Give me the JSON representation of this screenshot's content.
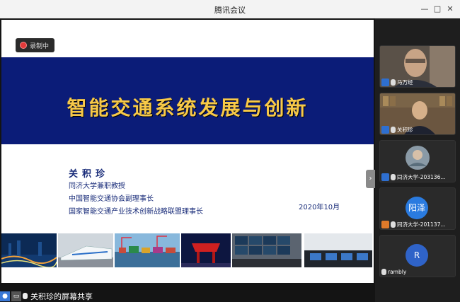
{
  "window": {
    "title": "腾讯会议",
    "controls": [
      "—",
      "□",
      "✕"
    ]
  },
  "recording": {
    "label": "录制中"
  },
  "slide": {
    "title": "智能交通系统发展与创新",
    "presenter": "关积珍",
    "roles": [
      "同济大学兼职教授",
      "中国智能交通协会副理事长",
      "国家智能交通产业技术创新战略联盟理事长"
    ],
    "date": "2020年10月"
  },
  "participants": [
    {
      "name": "马万经",
      "badge": "blue",
      "type": "video"
    },
    {
      "name": "关积珍",
      "badge": "blue",
      "type": "video"
    },
    {
      "name": "同济大学-203136...",
      "badge": "blue",
      "type": "video"
    },
    {
      "name": "同济大学-201137...",
      "badge": "orange",
      "type": "avatar",
      "avatar_text": "阳泽",
      "avatar_color": "#2a7be0"
    },
    {
      "name": "rambly",
      "badge": "none",
      "type": "avatar",
      "avatar_text": "R",
      "avatar_color": "#2f63c8"
    }
  ],
  "status": {
    "share_text": "关积珍的屏幕共享"
  },
  "colors": {
    "banner": "#0b1c78",
    "title": "#f7c948",
    "accent": "#2e6fd0"
  }
}
